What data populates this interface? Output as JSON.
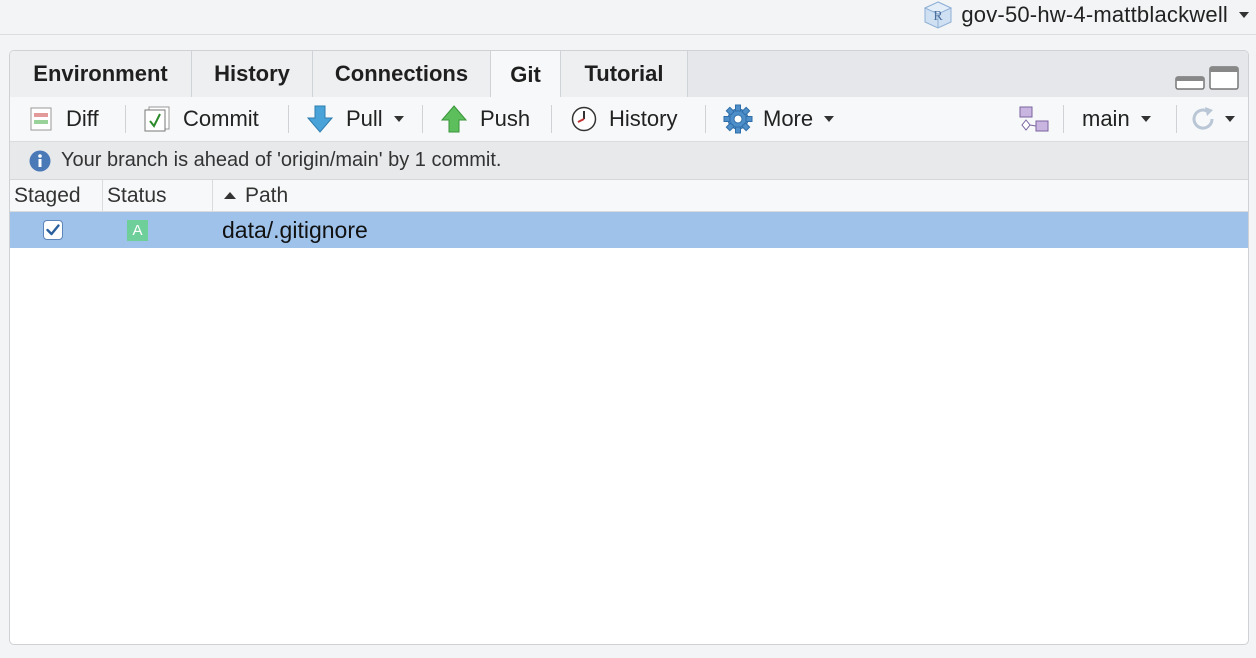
{
  "project": {
    "name": "gov-50-hw-4-mattblackwell",
    "icon": "r-project-icon"
  },
  "tabs": [
    {
      "label": "Environment",
      "active": false
    },
    {
      "label": "History",
      "active": false
    },
    {
      "label": "Connections",
      "active": false
    },
    {
      "label": "Git",
      "active": true
    },
    {
      "label": "Tutorial",
      "active": false
    }
  ],
  "toolbar": {
    "diff_label": "Diff",
    "commit_label": "Commit",
    "pull_label": "Pull",
    "push_label": "Push",
    "history_label": "History",
    "more_label": "More",
    "branch_label": "main"
  },
  "info": {
    "message": "Your branch is ahead of 'origin/main' by 1 commit."
  },
  "table": {
    "columns": [
      "Staged",
      "Status",
      "Path"
    ],
    "sort_column": "Path",
    "rows": [
      {
        "staged": true,
        "status": "A",
        "path": "data/.gitignore"
      }
    ]
  },
  "colors": {
    "selected_row": "#9fc2ea",
    "added_badge": "#6fcf9b",
    "info_icon": "#4a79b8"
  }
}
